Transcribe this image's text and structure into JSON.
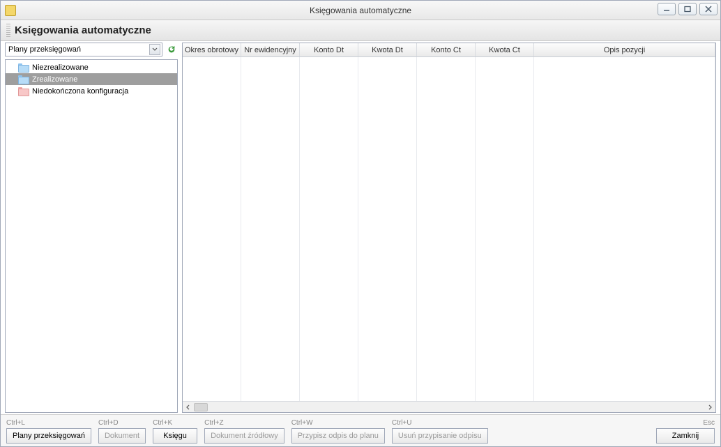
{
  "window": {
    "title": "Księgowania automatyczne"
  },
  "header": {
    "heading": "Księgowania automatyczne"
  },
  "sidebar": {
    "combo_label": "Plany przeksięgowań",
    "items": [
      {
        "label": "Niezrealizowane",
        "color": "blue",
        "selected": false
      },
      {
        "label": "Zrealizowane",
        "color": "blue",
        "selected": true
      },
      {
        "label": "Niedokończona konfiguracja",
        "color": "pink",
        "selected": false
      }
    ]
  },
  "grid": {
    "columns": [
      "Okres obrotowy",
      "Nr ewidencyjny",
      "Konto Dt",
      "Kwota Dt",
      "Konto Ct",
      "Kwota Ct",
      "Opis pozycji"
    ],
    "rows": []
  },
  "footer": {
    "buttons": [
      {
        "hint": "Ctrl+L",
        "label": "Plany przeksięgowań",
        "enabled": true
      },
      {
        "hint": "Ctrl+D",
        "label": "Dokument",
        "enabled": false
      },
      {
        "hint": "Ctrl+K",
        "label": "Księgu",
        "enabled": true
      },
      {
        "hint": "Ctrl+Z",
        "label": "Dokument źródłowy",
        "enabled": false
      },
      {
        "hint": "Ctrl+W",
        "label": "Przypisz odpis do planu",
        "enabled": false
      },
      {
        "hint": "Ctrl+U",
        "label": "Usuń przypisanie odpisu",
        "enabled": false
      }
    ],
    "close": {
      "hint": "Esc",
      "label": "Zamknij",
      "enabled": true
    }
  }
}
